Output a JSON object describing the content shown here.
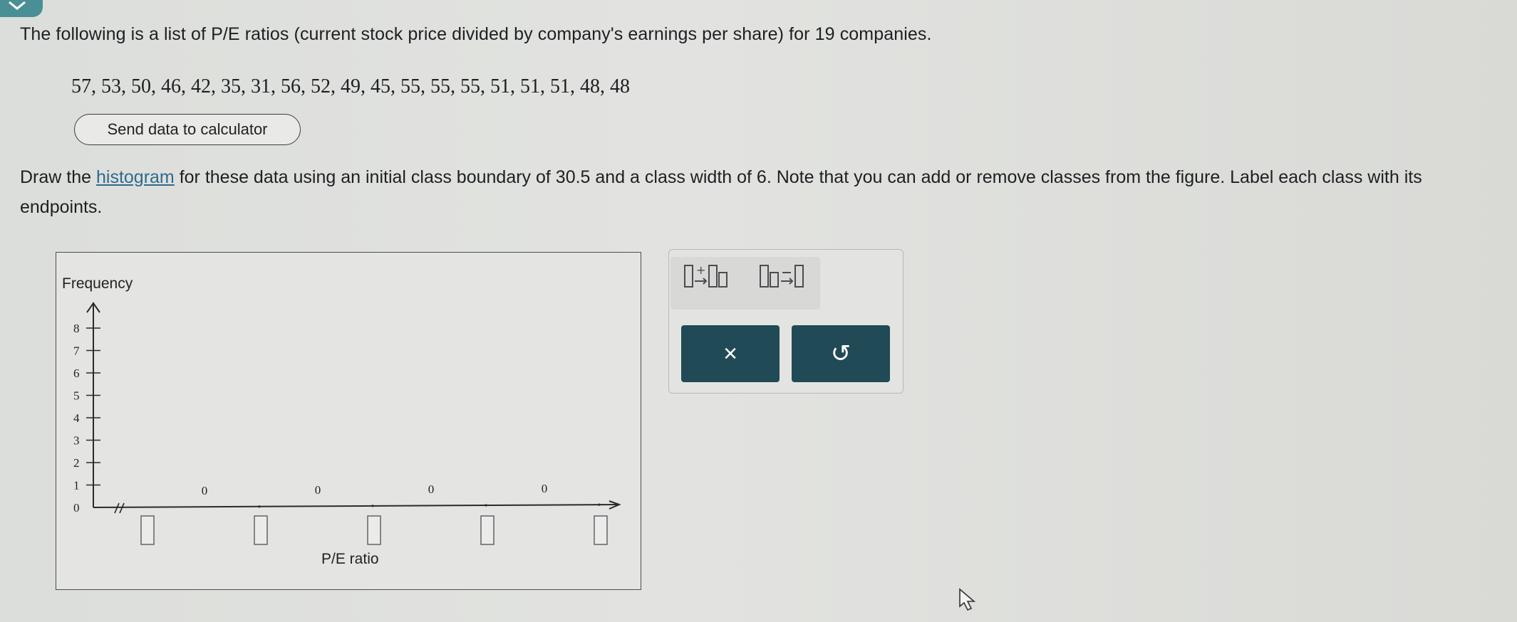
{
  "question": {
    "intro": "The following is a list of P/E ratios (current stock price divided by company's earnings per share) for 19 companies.",
    "data_values": "57, 53, 50, 46, 42, 35, 31, 56, 52, 49, 45, 55, 55, 55, 51, 51, 51, 48, 48",
    "send_button_label": "Send data to calculator",
    "instruction_before": "Draw the ",
    "instruction_link": "histogram",
    "instruction_after": " for these data using an initial class boundary of 30.5 and a class width of 6. Note that you can add or remove classes from the figure. Label each class with its endpoints."
  },
  "graph": {
    "y_axis_label": "Frequency",
    "x_axis_label": "P/E ratio",
    "y_ticks": [
      "0",
      "1",
      "2",
      "3",
      "4",
      "5",
      "6",
      "7",
      "8"
    ],
    "class_frequencies": [
      "0",
      "0",
      "0",
      "0"
    ],
    "endpoint_boxes": 5
  },
  "toolbar": {
    "add_class_icon": "add-class-icon",
    "remove_class_icon": "remove-class-icon",
    "clear_label": "×",
    "undo_label": "↺"
  },
  "colors": {
    "action_button": "#1f4a56",
    "accent_tab": "#4a8f96",
    "link": "#2f6a8e"
  }
}
